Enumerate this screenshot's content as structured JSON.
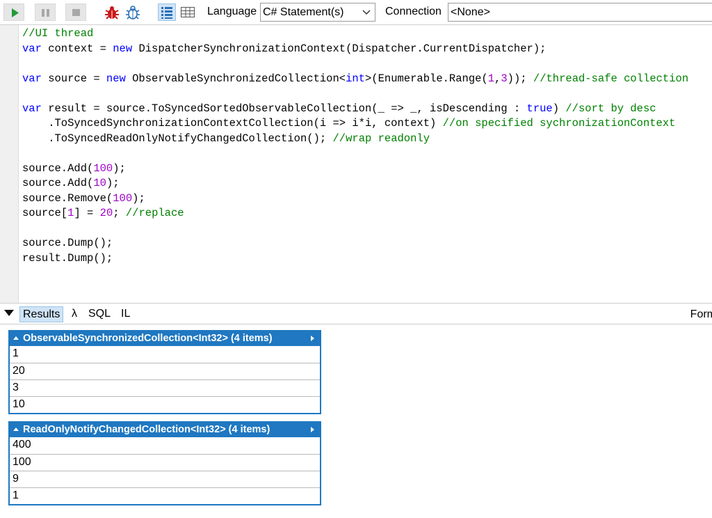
{
  "toolbar": {
    "language_label": "Language",
    "language_value": "C# Statement(s)",
    "connection_label": "Connection",
    "connection_value": "<None>",
    "icons": [
      "run-icon",
      "pause-icon",
      "stop-icon",
      "bug-red-icon",
      "bug-blue-icon",
      "rich-text-view-icon",
      "grid-view-icon"
    ]
  },
  "editor": {
    "lines": [
      [
        {
          "t": "cm",
          "s": "//UI thread"
        }
      ],
      [
        {
          "t": "kw",
          "s": "var"
        },
        {
          "t": "tx",
          "s": " context = "
        },
        {
          "t": "kw",
          "s": "new"
        },
        {
          "t": "tx",
          "s": " DispatcherSynchronizationContext(Dispatcher.CurrentDispatcher);"
        }
      ],
      [],
      [
        {
          "t": "kw",
          "s": "var"
        },
        {
          "t": "tx",
          "s": " source = "
        },
        {
          "t": "kw",
          "s": "new"
        },
        {
          "t": "tx",
          "s": " ObservableSynchronizedCollection<"
        },
        {
          "t": "kw",
          "s": "int"
        },
        {
          "t": "tx",
          "s": ">(Enumerable.Range("
        },
        {
          "t": "num",
          "s": "1"
        },
        {
          "t": "tx",
          "s": ","
        },
        {
          "t": "num",
          "s": "3"
        },
        {
          "t": "tx",
          "s": ")); "
        },
        {
          "t": "cm",
          "s": "//thread-safe collection"
        }
      ],
      [],
      [
        {
          "t": "kw",
          "s": "var"
        },
        {
          "t": "tx",
          "s": " result = source.ToSyncedSortedObservableCollection(_ => _, isDescending : "
        },
        {
          "t": "kw",
          "s": "true"
        },
        {
          "t": "tx",
          "s": ") "
        },
        {
          "t": "cm",
          "s": "//sort by desc"
        }
      ],
      [
        {
          "t": "tx",
          "s": "    .ToSyncedSynchronizationContextCollection(i => i*i, context) "
        },
        {
          "t": "cm",
          "s": "//on specified sychronizationContext"
        }
      ],
      [
        {
          "t": "tx",
          "s": "    .ToSyncedReadOnlyNotifyChangedCollection(); "
        },
        {
          "t": "cm",
          "s": "//wrap readonly"
        }
      ],
      [],
      [
        {
          "t": "tx",
          "s": "source.Add("
        },
        {
          "t": "num",
          "s": "100"
        },
        {
          "t": "tx",
          "s": ");"
        }
      ],
      [
        {
          "t": "tx",
          "s": "source.Add("
        },
        {
          "t": "num",
          "s": "10"
        },
        {
          "t": "tx",
          "s": ");"
        }
      ],
      [
        {
          "t": "tx",
          "s": "source.Remove("
        },
        {
          "t": "num",
          "s": "100"
        },
        {
          "t": "tx",
          "s": ");"
        }
      ],
      [
        {
          "t": "tx",
          "s": "source["
        },
        {
          "t": "num",
          "s": "1"
        },
        {
          "t": "tx",
          "s": "] = "
        },
        {
          "t": "num",
          "s": "20"
        },
        {
          "t": "tx",
          "s": "; "
        },
        {
          "t": "cm",
          "s": "//replace"
        }
      ],
      [],
      [
        {
          "t": "tx",
          "s": "source.Dump();"
        }
      ],
      [
        {
          "t": "tx",
          "s": "result.Dump();"
        }
      ]
    ]
  },
  "results_tabs": {
    "results": "Results",
    "lambda": "λ",
    "sql": "SQL",
    "il": "IL",
    "format": "Form"
  },
  "output": {
    "collections": [
      {
        "title": "ObservableSynchronizedCollection<Int32> (4 items)",
        "rows": [
          "1",
          "20",
          "3",
          "10"
        ]
      },
      {
        "title": "ReadOnlyNotifyChangedCollection<Int32> (4 items)",
        "rows": [
          "400",
          "100",
          "9",
          "1"
        ]
      }
    ]
  },
  "colors": {
    "accent": "#1f78c1",
    "keyword": "#0000ff",
    "comment": "#008000",
    "number": "#a000c8"
  }
}
